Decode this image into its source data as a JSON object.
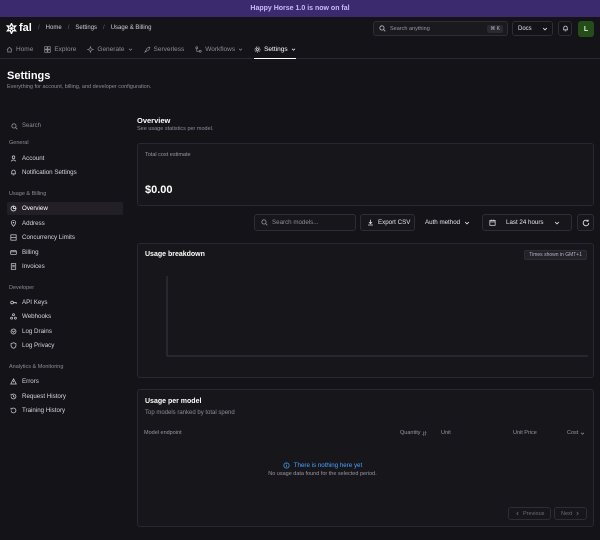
{
  "banner": {
    "text": "Happy Horse 1.0 is now on fal"
  },
  "topbar": {
    "logo_text": "fal",
    "breadcrumbs": [
      "Home",
      "Settings",
      "Usage & Billing"
    ],
    "search_placeholder": "Search anything",
    "search_shortcut": "⌘ K",
    "docs_label": "Docs",
    "avatar_initial": "L"
  },
  "nav": {
    "items": [
      {
        "label": "Home",
        "icon": "home-icon"
      },
      {
        "label": "Explore",
        "icon": "grid-icon"
      },
      {
        "label": "Generate",
        "icon": "sparkle-icon"
      },
      {
        "label": "Serverless",
        "icon": "rocket-icon"
      },
      {
        "label": "Workflows",
        "icon": "workflow-icon"
      },
      {
        "label": "Settings",
        "icon": "gear-icon",
        "active": true
      }
    ]
  },
  "page": {
    "title": "Settings",
    "subtitle": "Everything for account, billing, and developer configuration."
  },
  "sidebar": {
    "search_placeholder": "Search",
    "sections": [
      {
        "label": "General",
        "items": [
          {
            "label": "Account",
            "icon": "user-icon"
          },
          {
            "label": "Notification Settings",
            "icon": "bell-icon"
          }
        ]
      },
      {
        "label": "Usage & Billing",
        "items": [
          {
            "label": "Overview",
            "icon": "chart-icon",
            "active": true
          },
          {
            "label": "Address",
            "icon": "pin-icon"
          },
          {
            "label": "Concurrency Limits",
            "icon": "layers-icon"
          },
          {
            "label": "Billing",
            "icon": "card-icon"
          },
          {
            "label": "Invoices",
            "icon": "invoice-icon"
          }
        ]
      },
      {
        "label": "Developer",
        "items": [
          {
            "label": "API Keys",
            "icon": "key-icon"
          },
          {
            "label": "Webhooks",
            "icon": "webhook-icon"
          },
          {
            "label": "Log Drains",
            "icon": "drain-icon"
          },
          {
            "label": "Log Privacy",
            "icon": "shield-icon"
          }
        ]
      },
      {
        "label": "Analytics & Monitoring",
        "items": [
          {
            "label": "Errors",
            "icon": "warning-icon"
          },
          {
            "label": "Request History",
            "icon": "history-icon"
          },
          {
            "label": "Training History",
            "icon": "training-icon"
          }
        ]
      }
    ]
  },
  "overview": {
    "title": "Overview",
    "subtitle": "See usage statistics per model.",
    "total_cost_label": "Total cost estimate",
    "total_cost_value": "$0.00"
  },
  "filters": {
    "search_placeholder": "Search models...",
    "export_label": "Export CSV",
    "auth_method_label": "Auth method",
    "time_range_label": "Last 24 hours"
  },
  "usage_breakdown": {
    "title": "Usage breakdown",
    "timezone_note": "Times shown in GMT+1"
  },
  "usage_per_model": {
    "title": "Usage per model",
    "subtitle": "Top models ranked by total spend",
    "columns": [
      "Model endpoint",
      "Quantity",
      "Unit",
      "Unit Price",
      "Cost"
    ],
    "empty_title": "There is nothing here yet",
    "empty_subtitle": "No usage data found for the selected period.",
    "prev_label": "Previous",
    "next_label": "Next"
  },
  "colors": {
    "banner_bg": "#3b2a6e",
    "accent_blue": "#4aa3ff",
    "avatar_bg": "#254d19"
  }
}
